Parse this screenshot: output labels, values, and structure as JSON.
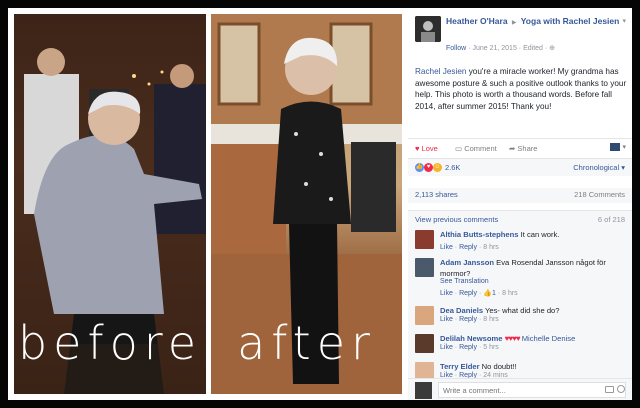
{
  "photo": {
    "before_label": "before",
    "after_label": "after"
  },
  "post": {
    "author": "Heather O'Hara",
    "group": "Yoga with Rachel Jesien",
    "follow": "Follow",
    "date": "June 21, 2015",
    "edited": "Edited",
    "mention": "Rachel Jesien",
    "text": " you're a miracle worker! My grandma has awesome posture & such a positive outlook thanks to your help. This photo is worth a thousand words. Before fall 2014, after summer 2015! Thank you!"
  },
  "actions": {
    "love": "Love",
    "comment": "Comment",
    "share": "Share"
  },
  "reactions": {
    "count": "2.6K",
    "sort": "Chronological"
  },
  "stats": {
    "shares": "2,113 shares",
    "comments": "218 Comments"
  },
  "comments_header": {
    "view_previous": "View previous comments",
    "position": "6 of 218"
  },
  "comments": [
    {
      "author": "Althia Butts-stephens",
      "text": "It can work.",
      "like": "Like",
      "reply": "Reply",
      "time": "8 hrs"
    },
    {
      "author": "Adam Jansson",
      "text": "Eva Rosendal Jansson något för mormor?",
      "translate": "See Translation",
      "like": "Like",
      "reply": "Reply",
      "likes": "1",
      "time": "8 hrs"
    },
    {
      "author": "Dea Daniels",
      "text": "Yes- what did she do?",
      "like": "Like",
      "reply": "Reply",
      "time": "8 hrs"
    },
    {
      "author": "Delilah Newsome",
      "text": "Michelle Denise",
      "like": "Like",
      "reply": "Reply",
      "time": "5 hrs"
    },
    {
      "author": "Terry Elder",
      "text": "No doubt!!",
      "like": "Like",
      "reply": "Reply",
      "time": "24 mins"
    }
  ],
  "composer": {
    "placeholder": "Write a comment..."
  },
  "colors": {
    "link": "#365899",
    "love": "#f0284a",
    "muted": "#90949c"
  }
}
